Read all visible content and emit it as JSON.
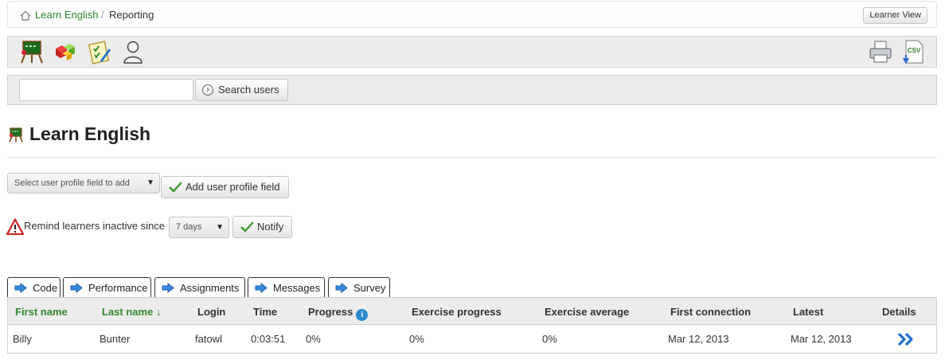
{
  "breadcrumb": {
    "home_link": "Learn English",
    "separator": "/",
    "current": "Reporting"
  },
  "header": {
    "learner_view_label": "Learner View"
  },
  "toolbar": {
    "left_icons": [
      "course-icon",
      "reporting-icon",
      "checklist-icon",
      "user-icon"
    ],
    "right_icons": [
      "print-icon",
      "csv-export-icon"
    ],
    "csv_label": "CSV"
  },
  "search": {
    "value": "",
    "placeholder": "",
    "button_label": "Search users",
    "button_glyph": "›"
  },
  "course": {
    "title": "Learn English"
  },
  "profile_field": {
    "select_label": "Select user profile field to add",
    "caret": "▼",
    "add_button_label": "Add user profile field"
  },
  "remind": {
    "label": "Remind learners inactive since",
    "select_value": "7 days",
    "caret": "▼",
    "notify_label": "Notify"
  },
  "tabs": [
    {
      "label": "Code"
    },
    {
      "label": "Performance"
    },
    {
      "label": "Assignments"
    },
    {
      "label": "Messages"
    },
    {
      "label": "Survey"
    }
  ],
  "table": {
    "headers": {
      "first_name": "First name",
      "last_name": "Last name ↓",
      "login": "Login",
      "time": "Time",
      "progress": "Progress",
      "progress_info": "i",
      "exercise_progress": "Exercise progress",
      "exercise_average": "Exercise average",
      "first_connection": "First connection",
      "latest": "Latest",
      "details": "Details"
    },
    "rows": [
      {
        "first_name": "Billy",
        "last_name": "Bunter",
        "login": "fatowl",
        "time": "0:03:51",
        "progress": "0%",
        "exercise_progress": "0%",
        "exercise_average": "0%",
        "first_connection": "Mar 12, 2013",
        "latest": "Mar 12, 2013",
        "details_icon": "double-chevron-right-icon"
      }
    ]
  },
  "colors": {
    "link_green": "#2f8a2f",
    "bar_gray": "#ececec",
    "info_blue": "#2a88d0",
    "details_blue": "#1f6fd0"
  }
}
